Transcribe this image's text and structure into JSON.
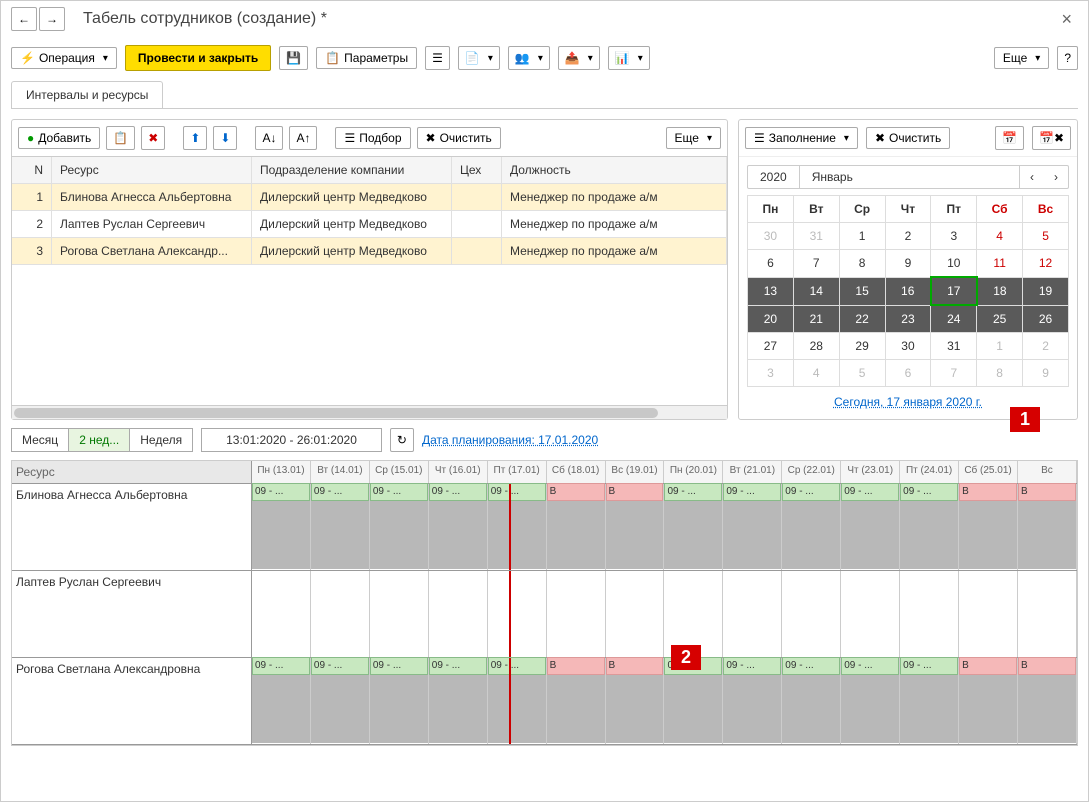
{
  "header": {
    "title": "Табель сотрудников (создание) *"
  },
  "toolbar": {
    "operation": "Операция",
    "post_close": "Провести и закрыть",
    "params": "Параметры",
    "more": "Еще"
  },
  "tabs": {
    "intervals": "Интервалы и ресурсы"
  },
  "pane_toolbar": {
    "add": "Добавить",
    "pick": "Подбор",
    "clear": "Очистить",
    "more": "Еще",
    "fill": "Заполнение",
    "clear2": "Очистить"
  },
  "grid": {
    "headers": {
      "n": "N",
      "res": "Ресурс",
      "dep": "Подразделение компании",
      "shop": "Цех",
      "pos": "Должность"
    },
    "rows": [
      {
        "n": "1",
        "res": "Блинова Агнесса Альбертовна",
        "dep": "Дилерский центр Медведково",
        "shop": "",
        "pos": "Менеджер по продаже а/м",
        "sel": true
      },
      {
        "n": "2",
        "res": "Лаптев Руслан Сергеевич",
        "dep": "Дилерский центр Медведково",
        "shop": "",
        "pos": "Менеджер по продаже а/м",
        "sel": false
      },
      {
        "n": "3",
        "res": "Рогова Светлана Александр...",
        "dep": "Дилерский центр Медведково",
        "shop": "",
        "pos": "Менеджер по продаже а/м",
        "sel": true
      }
    ]
  },
  "calendar": {
    "year": "2020",
    "month": "Январь",
    "dow": [
      "Пн",
      "Вт",
      "Ср",
      "Чт",
      "Пт",
      "Сб",
      "Вс"
    ],
    "weeks": [
      [
        {
          "d": "30",
          "dim": true
        },
        {
          "d": "31",
          "dim": true
        },
        {
          "d": "1"
        },
        {
          "d": "2"
        },
        {
          "d": "3"
        },
        {
          "d": "4",
          "wk": true
        },
        {
          "d": "5",
          "wk": true
        }
      ],
      [
        {
          "d": "6"
        },
        {
          "d": "7"
        },
        {
          "d": "8"
        },
        {
          "d": "9"
        },
        {
          "d": "10"
        },
        {
          "d": "11",
          "wk": true
        },
        {
          "d": "12",
          "wk": true
        }
      ],
      [
        {
          "d": "13",
          "sr": true
        },
        {
          "d": "14",
          "sr": true
        },
        {
          "d": "15",
          "sr": true
        },
        {
          "d": "16",
          "sr": true
        },
        {
          "d": "17",
          "sr": true,
          "today": true
        },
        {
          "d": "18",
          "sr": true
        },
        {
          "d": "19",
          "sr": true
        }
      ],
      [
        {
          "d": "20",
          "sr": true
        },
        {
          "d": "21",
          "sr": true
        },
        {
          "d": "22",
          "sr": true
        },
        {
          "d": "23",
          "sr": true
        },
        {
          "d": "24",
          "sr": true
        },
        {
          "d": "25",
          "sr": true
        },
        {
          "d": "26",
          "sr": true
        }
      ],
      [
        {
          "d": "27"
        },
        {
          "d": "28"
        },
        {
          "d": "29"
        },
        {
          "d": "30"
        },
        {
          "d": "31"
        },
        {
          "d": "1",
          "dim": true
        },
        {
          "d": "2",
          "dim": true
        }
      ],
      [
        {
          "d": "3",
          "dim": true
        },
        {
          "d": "4",
          "dim": true
        },
        {
          "d": "5",
          "dim": true
        },
        {
          "d": "6",
          "dim": true
        },
        {
          "d": "7",
          "dim": true
        },
        {
          "d": "8",
          "dim": true
        },
        {
          "d": "9",
          "dim": true
        }
      ]
    ],
    "today_link": "Сегодня, 17 января 2020 г."
  },
  "planner_toolbar": {
    "view_month": "Месяц",
    "view_2w": "2 нед...",
    "view_week": "Неделя",
    "date_range": "13:01:2020 - 26:01:2020",
    "plan_date": "Дата планирования: 17.01.2020"
  },
  "planner": {
    "res_header": "Ресурс",
    "days": [
      "Пн (13.01)",
      "Вт (14.01)",
      "Ср (15.01)",
      "Чт (16.01)",
      "Пт (17.01)",
      "Сб (18.01)",
      "Вс (19.01)",
      "Пн (20.01)",
      "Вт (21.01)",
      "Ср (22.01)",
      "Чт (23.01)",
      "Пт (24.01)",
      "Сб (25.01)",
      "Вс"
    ],
    "rows": [
      {
        "name": "Блинова Агнесса Альбертовна",
        "cells": [
          "09 - ...",
          "09 - ...",
          "09 - ...",
          "09 - ...",
          "09 - ...",
          "В",
          "В",
          "09 - ...",
          "09 - ...",
          "09 - ...",
          "09 - ...",
          "09 - ...",
          "В",
          "В"
        ]
      },
      {
        "name": "Лаптев Руслан Сергеевич",
        "cells": [
          "",
          "",
          "",
          "",
          "",
          "",
          "",
          "",
          "",
          "",
          "",
          "",
          "",
          ""
        ]
      },
      {
        "name": "Рогова Светлана Александровна",
        "cells": [
          "09 - ...",
          "09 - ...",
          "09 - ...",
          "09 - ...",
          "09 - ...",
          "В",
          "В",
          "09 - ...",
          "09 - ...",
          "09 - ...",
          "09 - ...",
          "09 - ...",
          "В",
          "В"
        ]
      }
    ]
  },
  "badges": {
    "b1": "1",
    "b2": "2"
  }
}
